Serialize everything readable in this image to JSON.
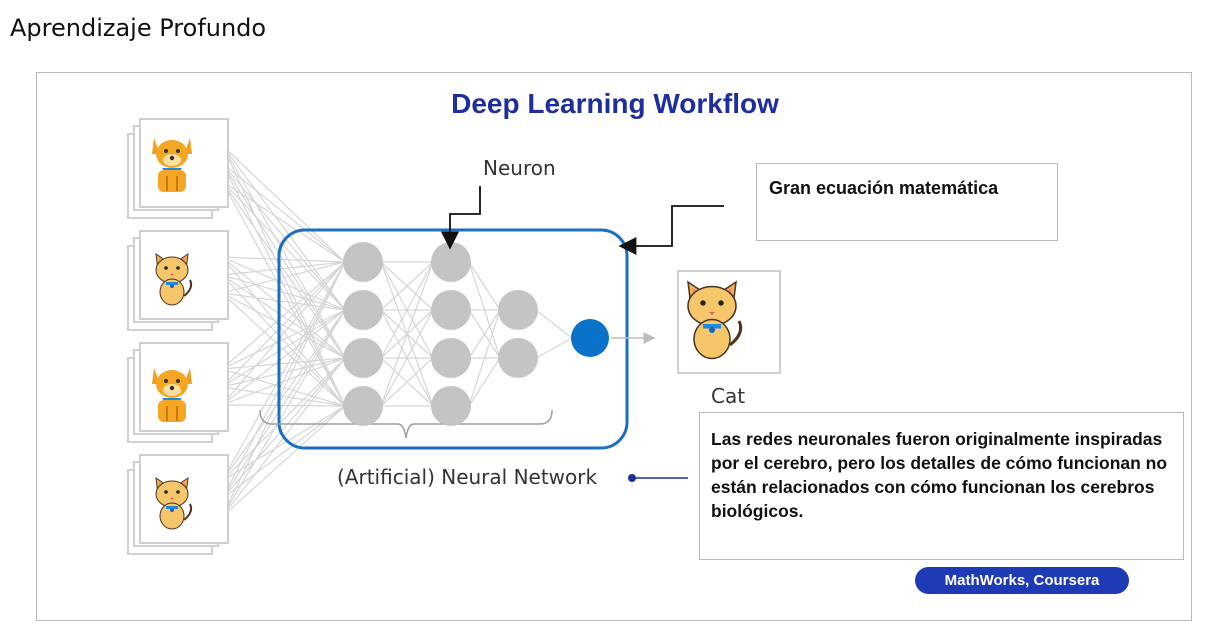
{
  "page_heading": "Aprendizaje Profundo",
  "diagram": {
    "title": "Deep Learning Workflow",
    "neuron_label": "Neuron",
    "network_label": "(Artificial) Neural Network",
    "output_label": "Cat",
    "math_box_text": "Gran ecuación matemática",
    "note_text": "Las redes neuronales fueron originalmente inspiradas por el cerebro, pero los detalles de cómo funcionan no están relacionados con cómo funcionan los cerebros biológicos.",
    "source_badge": "MathWorks, Coursera",
    "input_images": [
      "dog-icon",
      "cat-icon",
      "dog-icon",
      "cat-icon"
    ],
    "output_image": "cat-icon",
    "layers": [
      4,
      4,
      2,
      1
    ],
    "colors": {
      "title": "#1e2e9a",
      "network_border": "#1b6fc0",
      "neuron": "#c4c4c4",
      "output_neuron": "#0a72c8",
      "badge": "#1e3bb5"
    }
  }
}
